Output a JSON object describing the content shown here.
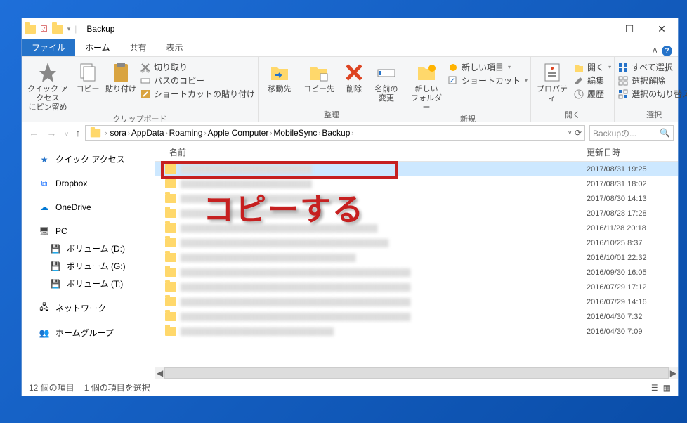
{
  "title": "Backup",
  "tabs": {
    "file": "ファイル",
    "home": "ホーム",
    "share": "共有",
    "view": "表示"
  },
  "ribbon": {
    "clipboard": {
      "quick_access": "クイック アクセス\nにピン留め",
      "copy": "コピー",
      "paste": "貼り付け",
      "cut": "切り取り",
      "copy_path": "パスのコピー",
      "paste_shortcut": "ショートカットの貼り付け",
      "label": "クリップボード"
    },
    "organize": {
      "move_to": "移動先",
      "copy_to": "コピー先",
      "delete": "削除",
      "rename": "名前の\n変更",
      "label": "整理"
    },
    "new": {
      "new_folder": "新しい\nフォルダー",
      "new_item": "新しい項目",
      "shortcut": "ショートカット",
      "label": "新規"
    },
    "open": {
      "properties": "プロパティ",
      "open": "開く",
      "edit": "編集",
      "history": "履歴",
      "label": "開く"
    },
    "select": {
      "select_all": "すべて選択",
      "select_none": "選択解除",
      "invert": "選択の切り替え",
      "label": "選択"
    }
  },
  "breadcrumbs": [
    "sora",
    "AppData",
    "Roaming",
    "Apple Computer",
    "MobileSync",
    "Backup"
  ],
  "search_placeholder": "Backupの...",
  "nav": {
    "quick_access": "クイック アクセス",
    "dropbox": "Dropbox",
    "onedrive": "OneDrive",
    "pc": "PC",
    "vol_d": "ボリューム (D:)",
    "vol_g": "ボリューム (G:)",
    "vol_t": "ボリューム (T:)",
    "network": "ネットワーク",
    "homegroup": "ホームグループ"
  },
  "columns": {
    "name": "名前",
    "date": "更新日時"
  },
  "rows": [
    {
      "name": "████████████████████████",
      "date": "2017/08/31 19:25"
    },
    {
      "name": "████████████████████████",
      "date": "2017/08/31 18:02"
    },
    {
      "name": "████████████████████████████████",
      "date": "2017/08/30 14:13"
    },
    {
      "name": "██████████████████████████",
      "date": "2017/08/28 17:28"
    },
    {
      "name": "████████████████████████████████████",
      "date": "2016/11/28 20:18"
    },
    {
      "name": "██████████████████████████████████████",
      "date": "2016/10/25 8:37"
    },
    {
      "name": "████████████████████████████████",
      "date": "2016/10/01 22:32"
    },
    {
      "name": "██████████████████████████████████████████",
      "date": "2016/09/30 16:05"
    },
    {
      "name": "██████████████████████████████████████████",
      "date": "2016/07/29 17:12"
    },
    {
      "name": "██████████████████████████████████████████",
      "date": "2016/07/29 14:16"
    },
    {
      "name": "██████████████████████████████████████████",
      "date": "2016/04/30 7:32"
    },
    {
      "name": "████████████████████████████",
      "date": "2016/04/30 7:09"
    }
  ],
  "status": {
    "count": "12 個の項目",
    "selected": "1 個の項目を選択"
  },
  "overlay_label": "コピーする"
}
